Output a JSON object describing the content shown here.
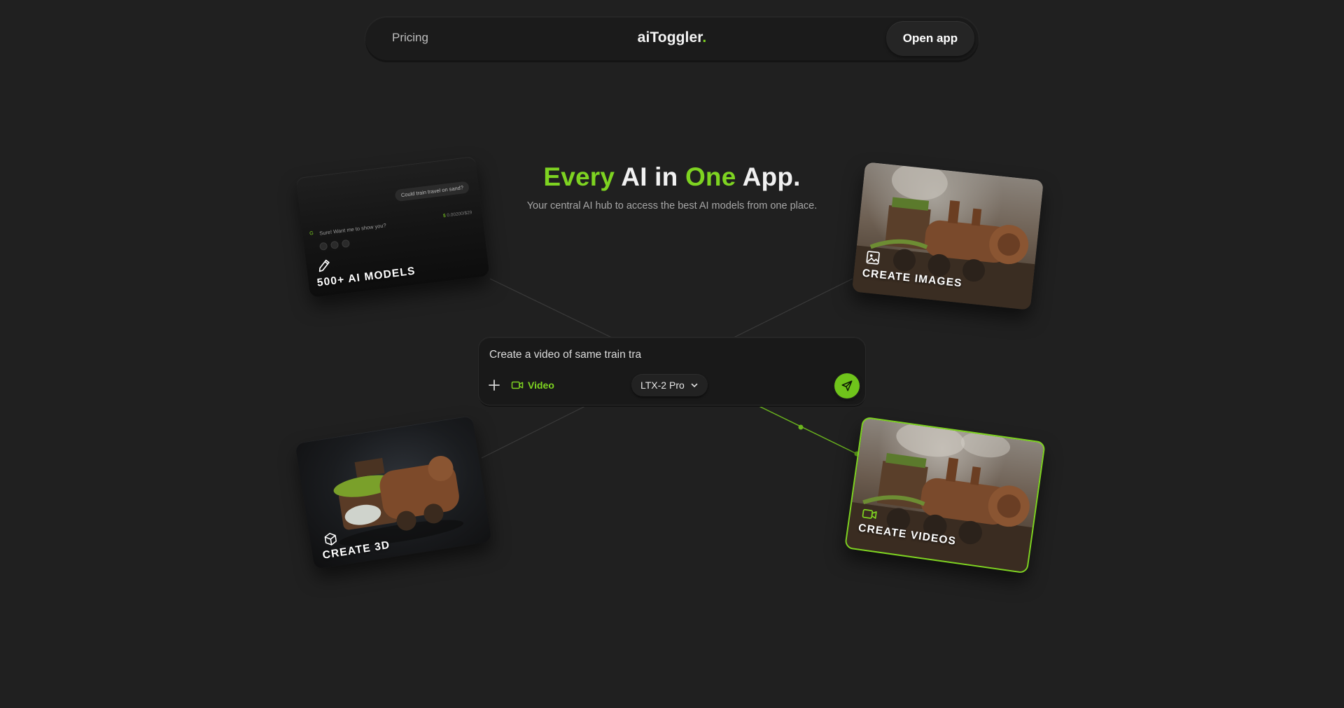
{
  "nav": {
    "pricing_label": "Pricing",
    "brand_name": "aiToggler",
    "brand_dot": ".",
    "open_app_label": "Open app"
  },
  "hero": {
    "title_word1": "Every",
    "title_word2": " AI in ",
    "title_word3": "One",
    "title_word4": " App.",
    "subtitle": "Your central AI hub to access the best AI models from one place."
  },
  "cards": {
    "models": {
      "label": "500+ AI MODELS",
      "icon": "pencil-icon",
      "chat_question": "Could train travel on sand?",
      "chat_reply": "Sure! Want me to show you?",
      "chat_cost": "0.00200/$29"
    },
    "images": {
      "label": "CREATE IMAGES",
      "icon": "image-icon"
    },
    "three_d": {
      "label": "CREATE 3D",
      "icon": "cube-icon"
    },
    "videos": {
      "label": "CREATE VIDEOS",
      "icon": "video-camera-icon",
      "active": true
    }
  },
  "prompt": {
    "input_value": "Create a video of same train tra",
    "mode_label": "Video",
    "model_label": "LTX-2 Pro"
  },
  "colors": {
    "accent": "#7ed321",
    "background": "#202020",
    "send_button": "#6fc41b"
  }
}
